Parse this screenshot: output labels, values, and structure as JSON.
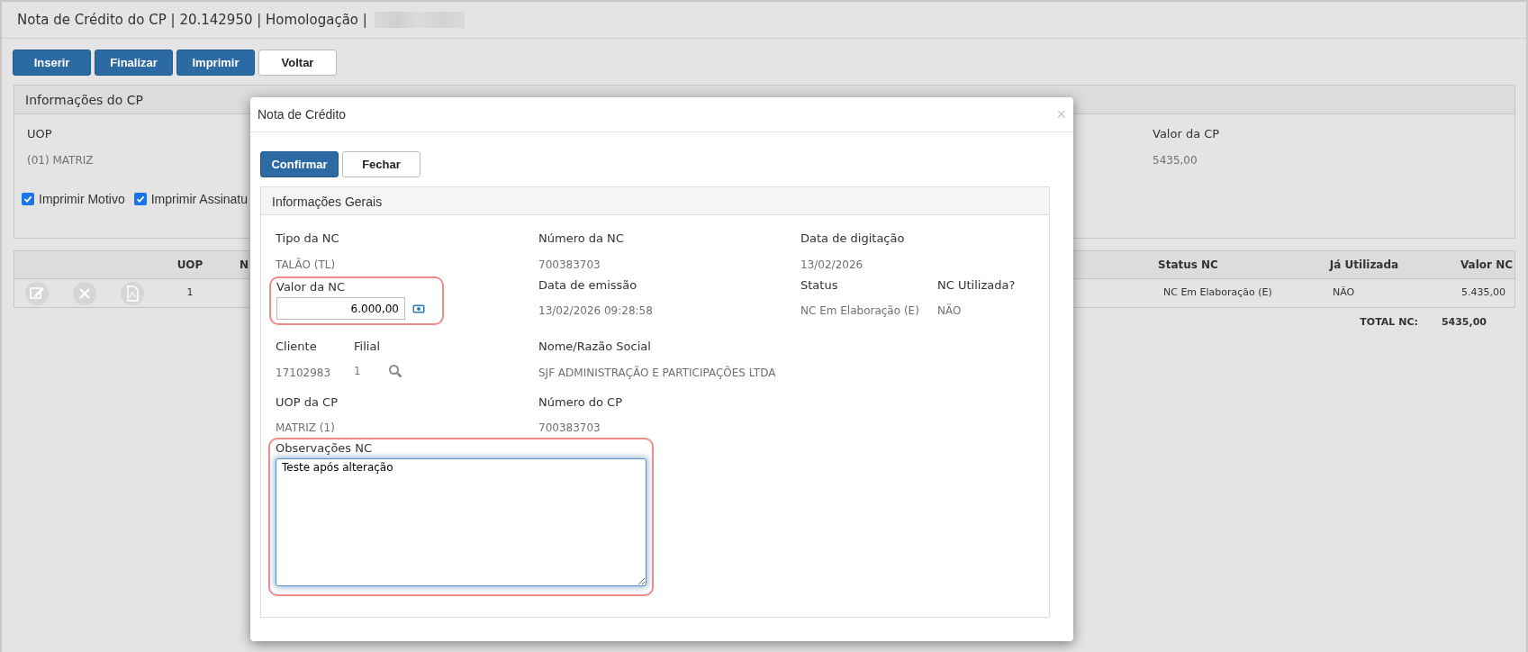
{
  "header": {
    "title": "Nota de Crédito do CP | 20.142950 | Homologação |"
  },
  "toolbar": [
    {
      "label": "Inserir",
      "kind": "primary"
    },
    {
      "label": "Finalizar",
      "kind": "primary"
    },
    {
      "label": "Imprimir",
      "kind": "primary"
    },
    {
      "label": "Voltar",
      "kind": "default"
    }
  ],
  "cp_panel": {
    "title": "Informações do CP",
    "fields": [
      {
        "label": "UOP",
        "value": "(01) MATRIZ"
      },
      {
        "label": "Valor da CP",
        "value": "5435,00"
      }
    ],
    "checkboxes": [
      {
        "label": "Imprimir Motivo",
        "checked": true
      },
      {
        "label": "Imprimir Assinatu",
        "checked": true
      }
    ]
  },
  "table": {
    "columns": [
      "UOP",
      "N",
      "Status NC",
      "Já Utilizada",
      "Valor NC"
    ],
    "rows": [
      {
        "uop": "1",
        "status": "NC Em Elaboração (E)",
        "ja_utilizada": "NÃO",
        "valor": "5.435,00"
      }
    ],
    "total": {
      "label": "TOTAL NC:",
      "value": "5435,00"
    }
  },
  "modal": {
    "title": "Nota de Crédito",
    "close": "×",
    "buttons": [
      {
        "label": "Confirmar",
        "kind": "primary"
      },
      {
        "label": "Fechar",
        "kind": "default"
      }
    ],
    "panel_title": "Informações Gerais",
    "rows": [
      [
        {
          "kind": "text",
          "label": "Tipo da NC",
          "value": "TALÃO (TL)"
        },
        {
          "kind": "text",
          "label": "Número da NC",
          "value": "700383703"
        },
        {
          "kind": "text",
          "label": "Data de digitação",
          "value": "13/02/2026"
        }
      ],
      [
        {
          "kind": "input",
          "label": "Valor da NC",
          "value": "6.000,00",
          "highlighted": true
        },
        {
          "kind": "text",
          "label": "Data de emissão",
          "value": "13/02/2026 09:28:58"
        },
        {
          "kind": "text",
          "label": "Status",
          "value": "NC Em Elaboração (E)"
        },
        {
          "kind": "text",
          "label": "NC Utilizada?",
          "value": "NÃO"
        }
      ],
      [
        {
          "kind": "pair",
          "fields": [
            {
              "kind": "text",
              "label": "Cliente",
              "value": "17102983"
            },
            {
              "kind": "lookup",
              "label": "Filial",
              "value": "1"
            }
          ]
        },
        {
          "kind": "text",
          "label": "Nome/Razão Social",
          "value": "SJF ADMINISTRAÇÃO E PARTICIPAÇÕES LTDA"
        }
      ],
      [
        {
          "kind": "text",
          "label": "UOP da CP",
          "value": "MATRIZ (1)"
        },
        {
          "kind": "text",
          "label": "Número do CP",
          "value": "700383703"
        }
      ],
      [
        {
          "kind": "textarea",
          "label": "Observações NC",
          "value": "Teste após alteração ",
          "highlighted": true
        }
      ]
    ]
  }
}
